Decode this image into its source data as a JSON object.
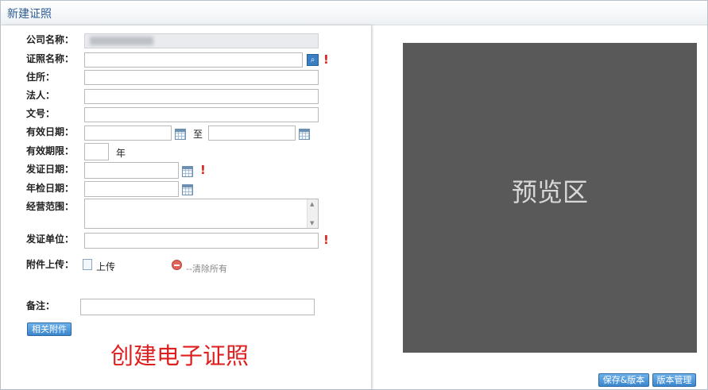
{
  "window": {
    "title": "新建证照"
  },
  "form": {
    "company_name": {
      "label": "公司名称："
    },
    "license_name": {
      "label": "证照名称："
    },
    "address": {
      "label": "住所："
    },
    "legal_person": {
      "label": "法人："
    },
    "doc_no": {
      "label": "文号："
    },
    "valid_date": {
      "label": "有效日期：",
      "separator": "至"
    },
    "valid_period": {
      "label": "有效期限：",
      "unit": "年"
    },
    "issue_date": {
      "label": "发证日期："
    },
    "annual_check_date": {
      "label": "年检日期："
    },
    "business_scope": {
      "label": "经营范围："
    },
    "issuing_authority": {
      "label": "发证单位："
    },
    "attachment": {
      "label": "附件上传：",
      "upload_text": "上传",
      "clear_text": "--清除所有"
    },
    "remark": {
      "label": "备注："
    },
    "related_attachments_button": "相关附件"
  },
  "overlay_caption": "创建电子证照",
  "preview": {
    "label": "预览区"
  },
  "footer": {
    "save_version_button": "保存&版本",
    "version_manage_button": "版本管理"
  },
  "colors": {
    "accent": "#3b86cc",
    "required": "#d9201c",
    "preview_bg": "#595959",
    "caption": "#dd1f1f"
  },
  "icons": [
    "search-icon",
    "calendar-icon",
    "required-icon",
    "upload-icon",
    "clear-icon"
  ]
}
